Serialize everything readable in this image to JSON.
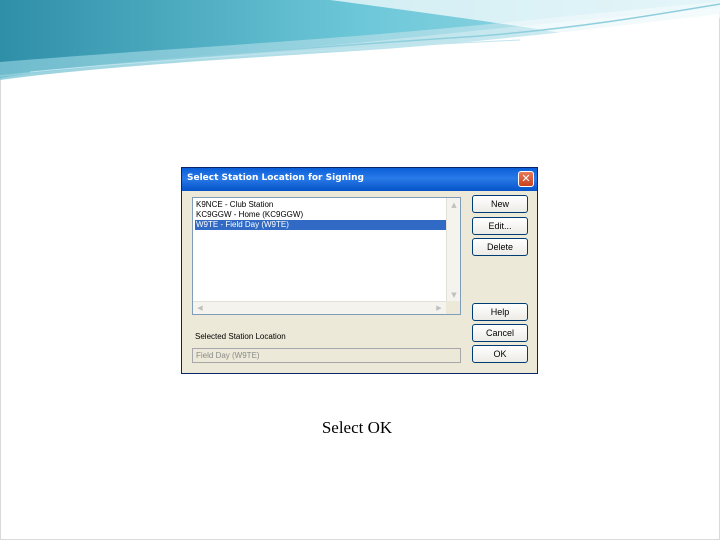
{
  "dialog": {
    "title": "Select Station Location for Signing",
    "close_glyph": "✕",
    "list_items": [
      "K9NCE - Club Station",
      "KC9GGW - Home (KC9GGW)",
      "W9TE - Field Day (W9TE)"
    ],
    "selected_index": 2,
    "buttons": {
      "new": "New",
      "edit": "Edit...",
      "delete": "Delete",
      "help": "Help",
      "cancel": "Cancel",
      "ok": "OK"
    },
    "selected_label": "Selected Station Location",
    "selected_value": "Field Day (W9TE)"
  },
  "caption": "Select OK",
  "colors": {
    "titlebar": "#0a5fd8",
    "selection": "#316ac5",
    "header_teal": "#4fb3c8"
  }
}
